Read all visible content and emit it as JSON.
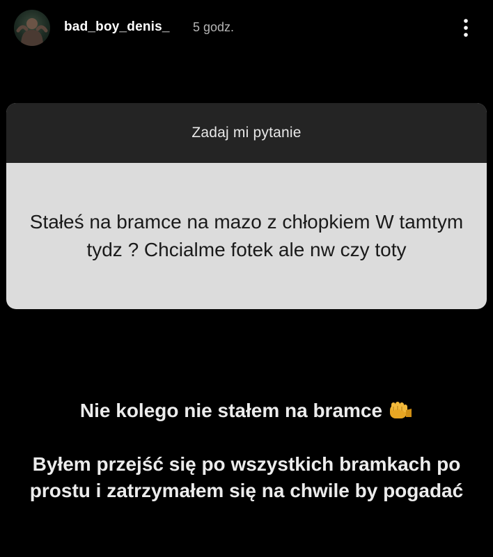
{
  "header": {
    "username": "bad_boy_denis_",
    "timestamp": "5 godz.",
    "avatar_icon": "profile-avatar",
    "more_icon": "vertical-ellipsis-icon"
  },
  "question_card": {
    "title": "Zadaj mi pytanie",
    "question": "Stałeś na bramce na mazo z chłopkiem W tamtym tydz ? Chcialme fotek ale nw czy toty"
  },
  "answer": {
    "line1": "Nie kolego nie stałem na bramce",
    "line1_emoji_icon": "oncoming-fist-icon",
    "line2": "Byłem przejść się po wszystkich bramkach po prostu i zatrzymałem się na chwile by pogadać"
  },
  "colors": {
    "background": "#000000",
    "card_header": "#242424",
    "card_body": "#dcdcdc",
    "secondary_text": "#b5b5b5"
  }
}
